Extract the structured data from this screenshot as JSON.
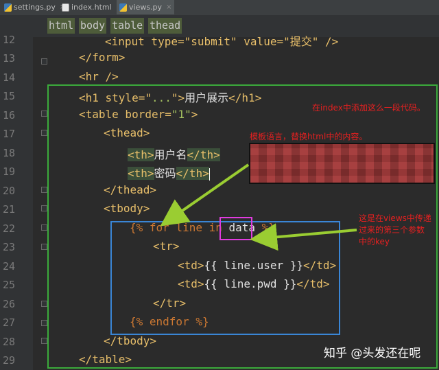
{
  "tabs": [
    {
      "label": "settings.py",
      "icon": "python-file-icon"
    },
    {
      "label": "index.html",
      "icon": "html-file-icon"
    },
    {
      "label": "views.py",
      "icon": "python-file-icon"
    }
  ],
  "tab_close_glyph": "×",
  "breadcrumbs": [
    "html",
    "body",
    "table",
    "thead"
  ],
  "line_numbers": [
    "12",
    "13",
    "14",
    "15",
    "16",
    "17",
    "18",
    "19",
    "20",
    "21",
    "22",
    "23",
    "24",
    "25",
    "26",
    "27",
    "28",
    "29"
  ],
  "code": {
    "l12": "<input type=\"submit\" value=\"提交\" />",
    "l13": "</form>",
    "l14": "<hr />",
    "l15_a": "<h1 style=\"",
    "l15_b": "...",
    "l15_c": "\">",
    "l15_d": "用户展示",
    "l15_e": "</h1>",
    "l16_a": "<table border=",
    "l16_b": "\"1\"",
    "l16_c": ">",
    "l17": "<thead>",
    "l18_a": "<th>",
    "l18_b": "用户名",
    "l18_c": "</th>",
    "l19_a": "<th>",
    "l19_b": "密码",
    "l19_c": "</th>",
    "l20": "</thead>",
    "l21": "<tbody>",
    "l22_a": "{% for line in ",
    "l22_b": "data",
    "l22_c": " %}",
    "l23": "<tr>",
    "l24_a": "<td>",
    "l24_b": "{{ line.user }}",
    "l24_c": "</td>",
    "l25_a": "<td>",
    "l25_b": "{{ line.pwd }}",
    "l25_c": "</td>",
    "l26": "</tr>",
    "l27": "{% endfor %}",
    "l28": "</tbody>",
    "l29": "</table>"
  },
  "annotations": {
    "index_note": "在index中添加这么一段代码。",
    "template_note": "模板语言，替换html中的内容。",
    "views_note_1": "这是在views中传递",
    "views_note_2": "过来的第三个参数",
    "views_note_3": "中的key"
  },
  "watermark": "知乎 @头发还在呢",
  "colors": {
    "editor_bg": "#2b2b2b",
    "tag": "#e8bf6a",
    "string": "#a5c261",
    "annotation_red": "#e62020",
    "green_box": "#3bab3b",
    "blue_box": "#3a86d6",
    "magenta_box": "#e13ce0"
  }
}
